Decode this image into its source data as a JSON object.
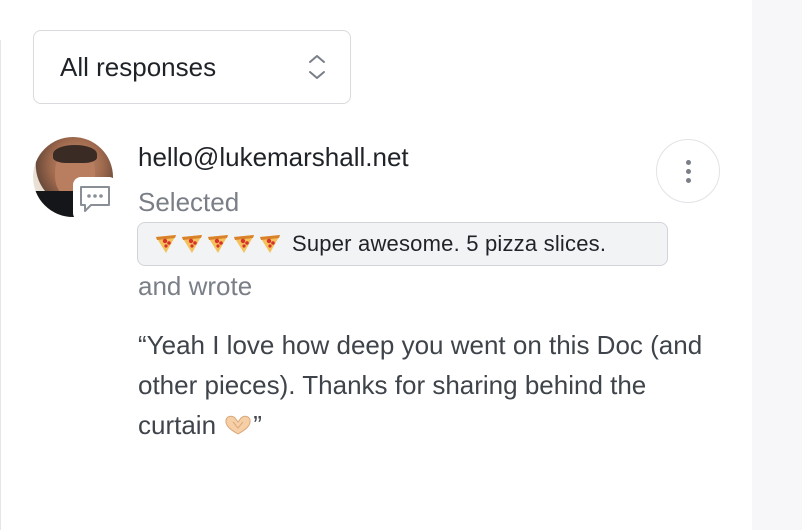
{
  "filter": {
    "selected_label": "All responses",
    "icon": "chevron-up-down-icon"
  },
  "response": {
    "email": "hello@lukemarshall.net",
    "selected_prefix": "Selected",
    "rating_icon": "pizza-slice-icon",
    "rating_count": 5,
    "rating_label": "Super awesome. 5 pizza slices.",
    "wrote_prefix": "and wrote",
    "quote_text": "“Yeah I love how deep you went on this Doc (and other pieces). Thanks for sharing behind the curtain ",
    "quote_emoji": "heart-hands-icon",
    "quote_close": "”",
    "badge_icon": "comment-icon",
    "menu_icon": "kebab-menu-icon"
  }
}
